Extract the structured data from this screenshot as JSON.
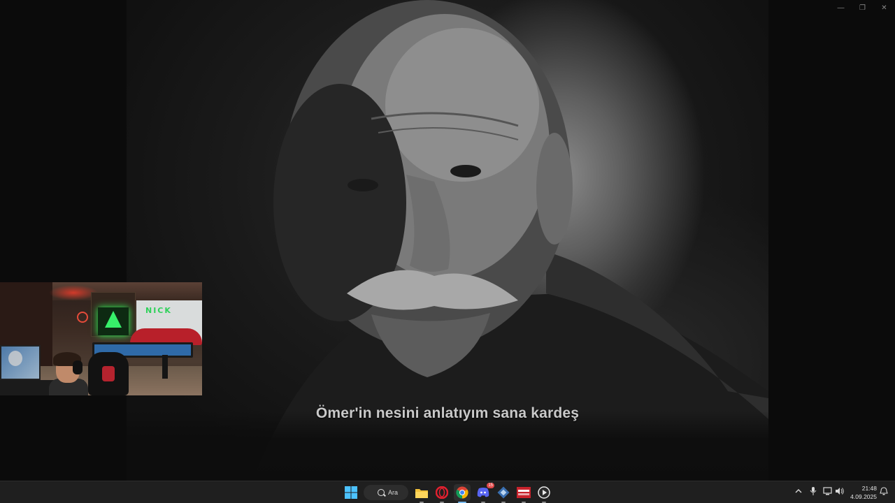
{
  "video": {
    "subtitle": "Ömer'in nesini anlatıyım sana kardeş"
  },
  "window_controls": {
    "minimize_glyph": "—",
    "restore_glyph": "❐",
    "close_glyph": "✕"
  },
  "webcam": {
    "wall_sign_text": "NICK"
  },
  "taskbar": {
    "search_label": "Ara",
    "apps": [
      {
        "name": "start-icon"
      },
      {
        "name": "file-explorer-icon"
      },
      {
        "name": "opera-icon"
      },
      {
        "name": "chrome-icon"
      },
      {
        "name": "discord-icon",
        "badge": "15"
      },
      {
        "name": "game-launcher-icon"
      },
      {
        "name": "streaming-app-icon"
      },
      {
        "name": "media-player-icon"
      }
    ],
    "tray": {
      "time": "21:48",
      "date": "4.09.2025"
    }
  },
  "colors": {
    "taskbar_bg": "#1f1f1f",
    "accent": "#76b9ed",
    "subtitle_color": "#c9c9c9"
  }
}
